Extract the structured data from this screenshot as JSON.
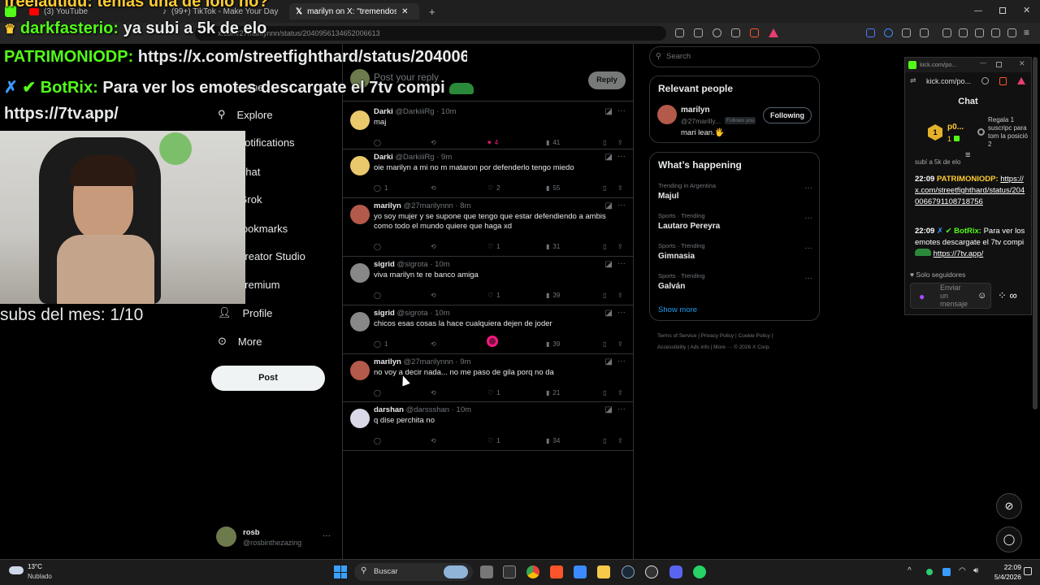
{
  "browser": {
    "tabs": [
      {
        "label": "(3) YouTube"
      },
      {
        "label": "(99+) TikTok - Make Your Day"
      },
      {
        "label": "marilyn on X: \"tremendos mogo"
      }
    ],
    "new_tab": "+",
    "url": "x.com/27marilynnn/status/2040956134652006613"
  },
  "overlay": {
    "line0": "freelautidu: tenias una de lolo no?",
    "line1_user": "darkfasterio:",
    "line1_text": " ya subi a 5k de elo",
    "line2_user": "PATRIMONIODP:",
    "line2_text": " https://x.com/streetfighthard/status/204006",
    "line3_user": "BotRix:",
    "line3_text": " Para ver los emotes descargate el 7tv compi",
    "line4": "https://7tv.app/",
    "subs": "subs del mes: 1/10"
  },
  "nav": {
    "items": [
      "Home",
      "Explore",
      "Notifications",
      "Chat",
      "Grok",
      "Bookmarks",
      "Creator Studio",
      "Premium",
      "Profile",
      "More"
    ],
    "post_label": "Post",
    "account_name": "rosb",
    "account_handle": "@rosbinthezazing",
    "account_more": "···"
  },
  "reply_box": {
    "placeholder": "Post your reply",
    "button": "Reply"
  },
  "tweets": [
    {
      "name": "Darki",
      "handle": "@DarkiiiRg",
      "time": "10m",
      "text": "maj",
      "replies": "",
      "reposts": "",
      "likes": "4",
      "views": "41",
      "liked": true
    },
    {
      "name": "Darki",
      "handle": "@DarkiiiRg",
      "time": "9m",
      "text": "oie marilyn a mi no m mataron por defenderlo tengo miedo",
      "replies": "1",
      "reposts": "",
      "likes": "2",
      "views": "55",
      "liked": false
    },
    {
      "name": "marilyn",
      "handle": "@27marilynnn",
      "time": "8m",
      "text": "yo soy mujer y se supone que tengo que estar defendiendo a ambis como todo el mundo quiere que haga xd",
      "replies": "",
      "reposts": "",
      "likes": "1",
      "views": "31",
      "liked": false
    },
    {
      "name": "sigrid",
      "handle": "@sigrota",
      "time": "10m",
      "text": "viva marilyn te re banco amiga",
      "replies": "",
      "reposts": "",
      "likes": "1",
      "views": "39",
      "liked": false
    },
    {
      "name": "sigrid",
      "handle": "@sigrota",
      "time": "10m",
      "text": "chicos esas cosas la hace cualquiera dejen de joder",
      "replies": "1",
      "reposts": "",
      "likes": "",
      "views": "39",
      "liked": false
    },
    {
      "name": "marilyn",
      "handle": "@27marilynnn",
      "time": "9m",
      "text": "no voy a decir nada... no me paso de gila porq no da",
      "replies": "",
      "reposts": "",
      "likes": "1",
      "views": "21",
      "liked": false
    },
    {
      "name": "darshan",
      "handle": "@darssshan",
      "time": "10m",
      "text": "q dise perchita no",
      "replies": "",
      "reposts": "",
      "likes": "1",
      "views": "34",
      "liked": false
    }
  ],
  "right": {
    "search_placeholder": "Search",
    "relevant_title": "Relevant people",
    "person_name": "marilyn",
    "person_handle": "@27marilly...",
    "person_badge": "Follows you",
    "person_bio": "mari lean.🖐",
    "follow_label": "Following",
    "happening_title": "What’s happening",
    "trends": [
      {
        "category": "Trending in Argentina",
        "name": "Majul"
      },
      {
        "category": "Sports · Trending",
        "name": "Lautaro Pereyra"
      },
      {
        "category": "Sports · Trending",
        "name": "Gimnasia"
      },
      {
        "category": "Sports · Trending",
        "name": "Galván"
      }
    ],
    "show_more": "Show more",
    "footer": [
      "Terms of Service",
      "Privacy Policy",
      "Cookie Policy",
      "Accessibility",
      "Ads info",
      "More ···",
      "© 2026 X Corp."
    ]
  },
  "kick": {
    "title_url": "kick.com/po...",
    "address": "kick.com/po...",
    "chat_title": "Chat",
    "pinned_user": "p0...",
    "pinned_count": "1",
    "pinned_text": "Regala 1 suscripc para tom la posició 2",
    "partial": "subí a 5k de elo",
    "msg1_time": "22:09",
    "msg1_user": "PATRIMONIODP:",
    "msg1_link": "https://x.com/streetfighthard/status/2040066791108718756",
    "msg2_time": "22:09",
    "msg2_user": "BotRix:",
    "msg2_text": " Para ver los emotes descargate el 7tv compi ",
    "msg2_link": "https://7tv.app/",
    "followers_mode": "Solo seguidores",
    "send_placeholder": "Enviar un mensaje"
  },
  "taskbar": {
    "temp": "13°C",
    "weather": "Nublado",
    "search": "Buscar",
    "time": "22:09",
    "date": "5/4/2026"
  },
  "colors": {
    "x_blue": "#1d9bf0",
    "kick_green": "#53fc18",
    "like_pink": "#f91880",
    "bg": "#000000"
  }
}
